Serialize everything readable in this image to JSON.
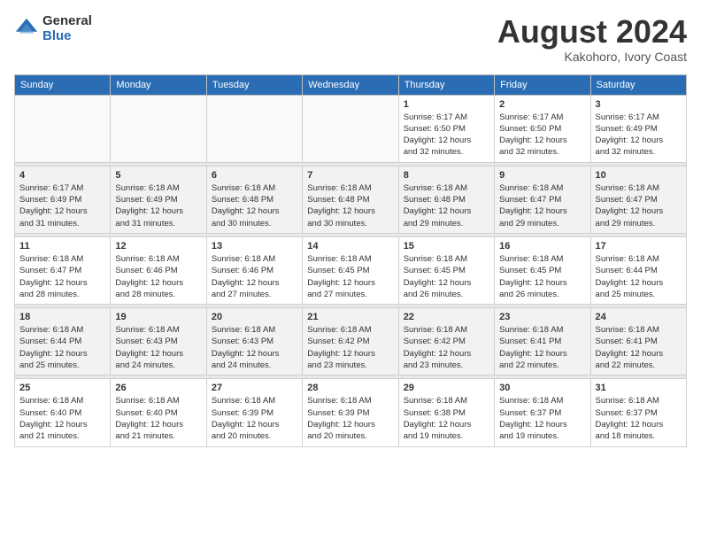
{
  "logo": {
    "general": "General",
    "blue": "Blue"
  },
  "title": "August 2024",
  "location": "Kakohoro, Ivory Coast",
  "days_of_week": [
    "Sunday",
    "Monday",
    "Tuesday",
    "Wednesday",
    "Thursday",
    "Friday",
    "Saturday"
  ],
  "weeks": [
    [
      {
        "day": "",
        "content": ""
      },
      {
        "day": "",
        "content": ""
      },
      {
        "day": "",
        "content": ""
      },
      {
        "day": "",
        "content": ""
      },
      {
        "day": "1",
        "content": "Sunrise: 6:17 AM\nSunset: 6:50 PM\nDaylight: 12 hours\nand 32 minutes."
      },
      {
        "day": "2",
        "content": "Sunrise: 6:17 AM\nSunset: 6:50 PM\nDaylight: 12 hours\nand 32 minutes."
      },
      {
        "day": "3",
        "content": "Sunrise: 6:17 AM\nSunset: 6:49 PM\nDaylight: 12 hours\nand 32 minutes."
      }
    ],
    [
      {
        "day": "4",
        "content": "Sunrise: 6:17 AM\nSunset: 6:49 PM\nDaylight: 12 hours\nand 31 minutes."
      },
      {
        "day": "5",
        "content": "Sunrise: 6:18 AM\nSunset: 6:49 PM\nDaylight: 12 hours\nand 31 minutes."
      },
      {
        "day": "6",
        "content": "Sunrise: 6:18 AM\nSunset: 6:48 PM\nDaylight: 12 hours\nand 30 minutes."
      },
      {
        "day": "7",
        "content": "Sunrise: 6:18 AM\nSunset: 6:48 PM\nDaylight: 12 hours\nand 30 minutes."
      },
      {
        "day": "8",
        "content": "Sunrise: 6:18 AM\nSunset: 6:48 PM\nDaylight: 12 hours\nand 29 minutes."
      },
      {
        "day": "9",
        "content": "Sunrise: 6:18 AM\nSunset: 6:47 PM\nDaylight: 12 hours\nand 29 minutes."
      },
      {
        "day": "10",
        "content": "Sunrise: 6:18 AM\nSunset: 6:47 PM\nDaylight: 12 hours\nand 29 minutes."
      }
    ],
    [
      {
        "day": "11",
        "content": "Sunrise: 6:18 AM\nSunset: 6:47 PM\nDaylight: 12 hours\nand 28 minutes."
      },
      {
        "day": "12",
        "content": "Sunrise: 6:18 AM\nSunset: 6:46 PM\nDaylight: 12 hours\nand 28 minutes."
      },
      {
        "day": "13",
        "content": "Sunrise: 6:18 AM\nSunset: 6:46 PM\nDaylight: 12 hours\nand 27 minutes."
      },
      {
        "day": "14",
        "content": "Sunrise: 6:18 AM\nSunset: 6:45 PM\nDaylight: 12 hours\nand 27 minutes."
      },
      {
        "day": "15",
        "content": "Sunrise: 6:18 AM\nSunset: 6:45 PM\nDaylight: 12 hours\nand 26 minutes."
      },
      {
        "day": "16",
        "content": "Sunrise: 6:18 AM\nSunset: 6:45 PM\nDaylight: 12 hours\nand 26 minutes."
      },
      {
        "day": "17",
        "content": "Sunrise: 6:18 AM\nSunset: 6:44 PM\nDaylight: 12 hours\nand 25 minutes."
      }
    ],
    [
      {
        "day": "18",
        "content": "Sunrise: 6:18 AM\nSunset: 6:44 PM\nDaylight: 12 hours\nand 25 minutes."
      },
      {
        "day": "19",
        "content": "Sunrise: 6:18 AM\nSunset: 6:43 PM\nDaylight: 12 hours\nand 24 minutes."
      },
      {
        "day": "20",
        "content": "Sunrise: 6:18 AM\nSunset: 6:43 PM\nDaylight: 12 hours\nand 24 minutes."
      },
      {
        "day": "21",
        "content": "Sunrise: 6:18 AM\nSunset: 6:42 PM\nDaylight: 12 hours\nand 23 minutes."
      },
      {
        "day": "22",
        "content": "Sunrise: 6:18 AM\nSunset: 6:42 PM\nDaylight: 12 hours\nand 23 minutes."
      },
      {
        "day": "23",
        "content": "Sunrise: 6:18 AM\nSunset: 6:41 PM\nDaylight: 12 hours\nand 22 minutes."
      },
      {
        "day": "24",
        "content": "Sunrise: 6:18 AM\nSunset: 6:41 PM\nDaylight: 12 hours\nand 22 minutes."
      }
    ],
    [
      {
        "day": "25",
        "content": "Sunrise: 6:18 AM\nSunset: 6:40 PM\nDaylight: 12 hours\nand 21 minutes."
      },
      {
        "day": "26",
        "content": "Sunrise: 6:18 AM\nSunset: 6:40 PM\nDaylight: 12 hours\nand 21 minutes."
      },
      {
        "day": "27",
        "content": "Sunrise: 6:18 AM\nSunset: 6:39 PM\nDaylight: 12 hours\nand 20 minutes."
      },
      {
        "day": "28",
        "content": "Sunrise: 6:18 AM\nSunset: 6:39 PM\nDaylight: 12 hours\nand 20 minutes."
      },
      {
        "day": "29",
        "content": "Sunrise: 6:18 AM\nSunset: 6:38 PM\nDaylight: 12 hours\nand 19 minutes."
      },
      {
        "day": "30",
        "content": "Sunrise: 6:18 AM\nSunset: 6:37 PM\nDaylight: 12 hours\nand 19 minutes."
      },
      {
        "day": "31",
        "content": "Sunrise: 6:18 AM\nSunset: 6:37 PM\nDaylight: 12 hours\nand 18 minutes."
      }
    ]
  ]
}
